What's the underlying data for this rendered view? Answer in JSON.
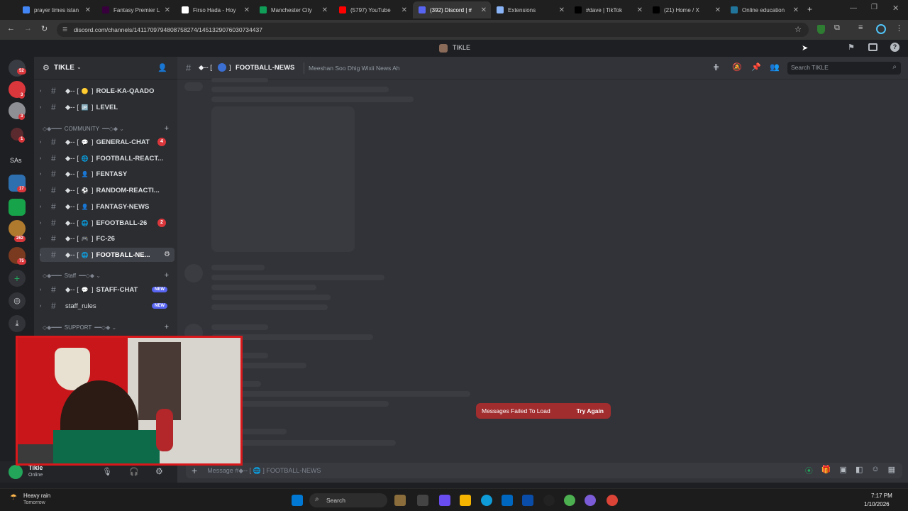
{
  "browser": {
    "tabs": [
      {
        "label": "prayer times istan",
        "color": "#4285f4",
        "active": false
      },
      {
        "label": "Fantasy Premier L",
        "color": "#37003c",
        "active": false
      },
      {
        "label": "Firso Hada - Hoy",
        "color": "#ffffff",
        "active": false
      },
      {
        "label": "Manchester City",
        "color": "#0f9d58",
        "active": false
      },
      {
        "label": "(5797) YouTube",
        "color": "#ff0000",
        "active": false
      },
      {
        "label": "(392) Discord | #",
        "color": "#5865f2",
        "active": true
      },
      {
        "label": "Extensions",
        "color": "#8ab4f8",
        "active": false
      },
      {
        "label": "#dave | TikTok",
        "color": "#000000",
        "active": false
      },
      {
        "label": "(21) Home / X",
        "color": "#000000",
        "active": false
      },
      {
        "label": "Online education",
        "color": "#21759b",
        "active": false
      }
    ],
    "url": "discord.com/channels/1411709794808758274/1451329076030734437"
  },
  "titlebar": {
    "server_name": "TIKLE"
  },
  "rail": {
    "badges": [
      "52",
      "3",
      "1",
      "17",
      "262",
      "75"
    ],
    "sas_label": "SAs"
  },
  "sidebar": {
    "server_title": "TIKLE",
    "channels_top": [
      {
        "label": "ROLE-KA-QAADO",
        "emoji": "🟡"
      },
      {
        "label": "LEVEL",
        "emoji": "🆙"
      }
    ],
    "community_label": "COMMUNITY",
    "community": [
      {
        "label": "GENERAL-CHAT",
        "emoji": "💬",
        "count": "4"
      },
      {
        "label": "FOOTBALL-REACT...",
        "emoji": "🌐",
        "count": ""
      },
      {
        "label": "FENTASY",
        "emoji": "👤",
        "count": ""
      },
      {
        "label": "RANDOM-REACTI...",
        "emoji": "⚽",
        "count": ""
      },
      {
        "label": "FANTASY-NEWS",
        "emoji": "👤",
        "count": ""
      },
      {
        "label": "EFOOTBALL-26",
        "emoji": "🌐",
        "count": "2"
      },
      {
        "label": "FC-26",
        "emoji": "🎮",
        "count": ""
      },
      {
        "label": "FOOTBALL-NE...",
        "emoji": "🌐",
        "count": ""
      }
    ],
    "staff_label": "Staff",
    "staff": [
      {
        "label": "STAFF-CHAT",
        "emoji": "💬",
        "tag": "NEW"
      }
    ],
    "staff_rules": {
      "label": "staff_rules",
      "tag": "NEW"
    },
    "support_label": "SUPPORT"
  },
  "user": {
    "name": "Tikle",
    "status": "Online"
  },
  "chat": {
    "channel_name": "FOOTBALL-NEWS",
    "channel_prefix": "◆-- [",
    "channel_suffix": "]",
    "topic": "Meeshan Soo Dhig Wixii News Ah",
    "search_placeholder": "Search TIKLE",
    "error_text": "Messages Failed To Load",
    "retry_label": "Try Again",
    "composer_placeholder": "Message #◆-- [ 🌐 ] FOOTBALL-NEWS"
  },
  "taskbar": {
    "weather_title": "Heavy rain",
    "weather_sub": "Tomorrow",
    "search_label": "Search",
    "time": "7:17 PM",
    "date": "1/10/2026"
  },
  "colors": {
    "accent": "#5865f2",
    "danger": "#da373c",
    "cam_border": "#d8181b"
  }
}
